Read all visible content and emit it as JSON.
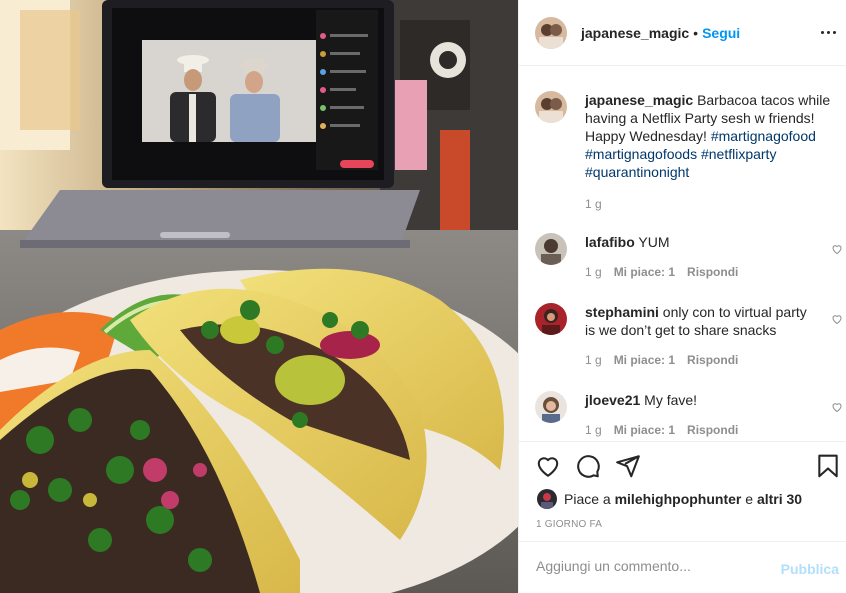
{
  "post": {
    "username": "japanese_magic",
    "follow_label": "Segui",
    "separator": "•"
  },
  "caption": {
    "username": "japanese_magic",
    "text": "Barbacoa tacos while having a Netflix Party sesh w friends! Happy Wednesday!",
    "hashtags": [
      "#martignagofood",
      "#martignagofoods",
      "#netflixparty",
      "#quarantinonight"
    ],
    "time": "1 g"
  },
  "comments": [
    {
      "username": "lafafibo",
      "text": "YUM",
      "time": "1 g",
      "likes": "Mi piace: 1",
      "reply": "Rispondi"
    },
    {
      "username": "stephamini",
      "text": "only con to virtual party is we don’t get to share snacks",
      "time": "1 g",
      "likes": "Mi piace: 1",
      "reply": "Rispondi"
    },
    {
      "username": "jloeve21",
      "text": "My fave!",
      "time": "1 g",
      "likes": "Mi piace: 1",
      "reply": "Rispondi"
    }
  ],
  "likes": {
    "prefix": "Piace a",
    "user": "milehighpophunter",
    "conj": "e",
    "others": "altri 30"
  },
  "date": "1 GIORNO FA",
  "add_comment": {
    "placeholder": "Aggiungi un commento...",
    "publish_label": "Pubblica"
  },
  "colors": {
    "link_blue": "#0095f6",
    "hashtag": "#00376b",
    "muted": "#8e8e8e",
    "publish_disabled": "#b2dffc"
  },
  "icons": [
    "more-options-icon",
    "heart-icon",
    "comment-icon",
    "share-icon",
    "bookmark-icon",
    "comment-like-heart-icon"
  ]
}
